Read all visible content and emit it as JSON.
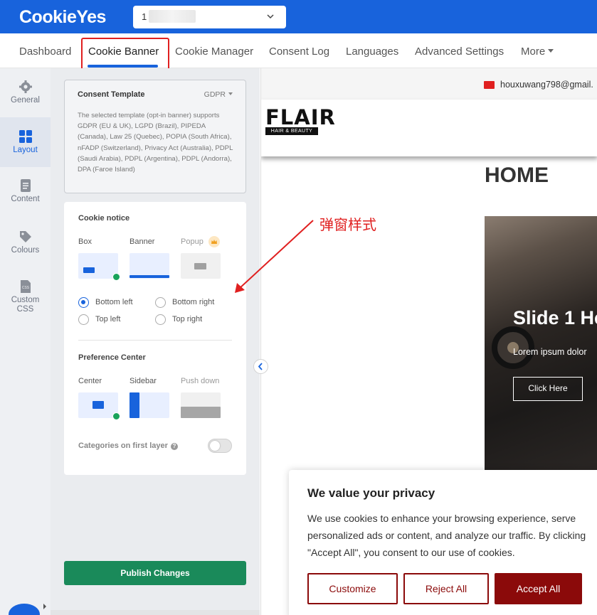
{
  "app": {
    "logo": "CookieYes",
    "site_selector_value": "1"
  },
  "tabs": [
    {
      "label": "Dashboard"
    },
    {
      "label": "Cookie Banner"
    },
    {
      "label": "Cookie Manager"
    },
    {
      "label": "Consent Log"
    },
    {
      "label": "Languages"
    },
    {
      "label": "Advanced Settings"
    },
    {
      "label": "More"
    }
  ],
  "sidebar": {
    "items": [
      {
        "label": "General",
        "icon": "gear-icon"
      },
      {
        "label": "Layout",
        "icon": "grid-icon"
      },
      {
        "label": "Content",
        "icon": "document-icon"
      },
      {
        "label": "Colours",
        "icon": "paint-tag-icon"
      },
      {
        "label": "Custom",
        "label2": "CSS",
        "icon": "css-file-icon"
      }
    ]
  },
  "consent_template": {
    "title": "Consent Template",
    "selected": "GDPR",
    "description": "The selected template (opt-in banner) supports GDPR (EU & UK), LGPD (Brazil), PIPEDA (Canada), Law 25 (Quebec), POPIA (South Africa), nFADP (Switzerland), Privacy Act (Australia), PDPL (Saudi Arabia), PDPL (Argentina), PDPL (Andorra), DPA (Faroe Island)"
  },
  "cookie_notice": {
    "title": "Cookie notice",
    "options": {
      "box": "Box",
      "banner": "Banner",
      "popup": "Popup"
    },
    "positions": {
      "bottom_left": "Bottom left",
      "bottom_right": "Bottom right",
      "top_left": "Top left",
      "top_right": "Top right"
    },
    "selected_position": "Bottom left"
  },
  "preference_center": {
    "title": "Preference Center",
    "options": {
      "center": "Center",
      "sidebar": "Sidebar",
      "push_down": "Push down"
    },
    "categories_label": "Categories on first layer",
    "categories_enabled": false
  },
  "publish_label": "Publish Changes",
  "annotation": "弹窗样式",
  "preview": {
    "email": "houxuwang798@gmail.",
    "logo_main": "FLAIR",
    "logo_sub": "HAIR & BEAUTY",
    "home_heading": "HOME",
    "slide_title": "Slide 1 He",
    "slide_text": "Lorem ipsum dolor",
    "slide_button": "Click Here"
  },
  "consent_banner": {
    "title": "We value your privacy",
    "text": "We use cookies to enhance your browsing experience, serve personalized ads or content, and analyze our traffic. By clicking \"Accept All\", you consent to our use of cookies.",
    "customize": "Customize",
    "reject": "Reject All",
    "accept": "Accept All"
  },
  "colors": {
    "brand_blue": "#1863dc",
    "publish_green": "#1a8a5a",
    "consent_red": "#8b0a0a",
    "annotation_red": "#e02020"
  }
}
